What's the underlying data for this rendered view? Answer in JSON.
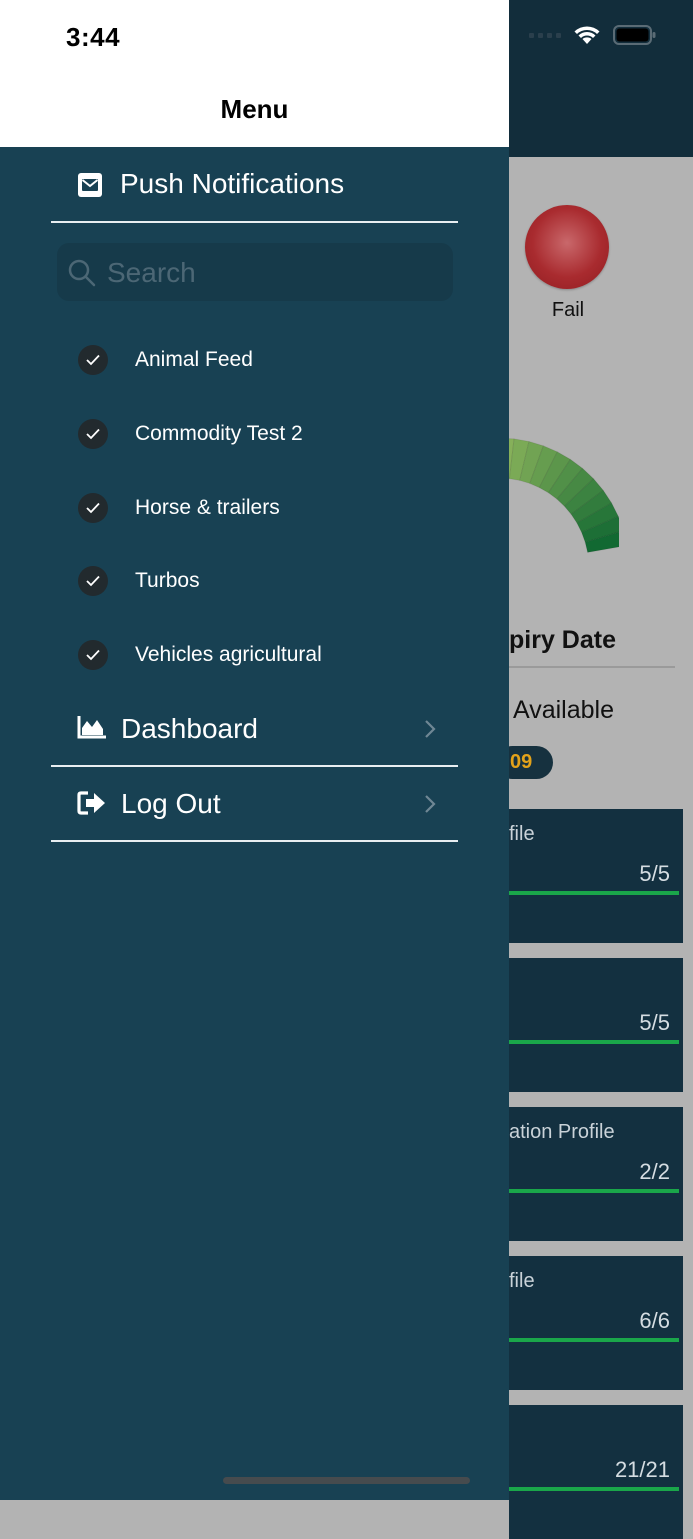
{
  "status_bar": {
    "time": "3:44"
  },
  "menu": {
    "title": "Menu",
    "push_notifications_label": "Push Notifications",
    "search": {
      "placeholder": "Search",
      "value": ""
    },
    "categories": [
      {
        "label": "Animal Feed",
        "checked": true
      },
      {
        "label": "Commodity Test 2",
        "checked": true
      },
      {
        "label": "Horse & trailers",
        "checked": true
      },
      {
        "label": "Turbos",
        "checked": true
      },
      {
        "label": "Vehicles agricultural",
        "checked": true
      }
    ],
    "dashboard_label": "Dashboard",
    "logout_label": "Log Out"
  },
  "background": {
    "status_label": "Fail",
    "expiry_title_partial": "piry Date",
    "available_label": "Available",
    "expiry_badge_partial": "09",
    "cards": [
      {
        "title_partial": "file",
        "count": "5/5"
      },
      {
        "title_partial": "",
        "count": "5/5"
      },
      {
        "title_partial": "ation Profile",
        "count": "2/2"
      },
      {
        "title_partial": "file",
        "count": "6/6"
      },
      {
        "title_partial": "",
        "count": "21/21"
      }
    ]
  },
  "colors": {
    "drawer_bg": "#184153",
    "header_bg": "#122d3b",
    "fail_red": "#a92b2f",
    "progress_green": "#1aa64a",
    "badge_text": "#e3a21a"
  }
}
